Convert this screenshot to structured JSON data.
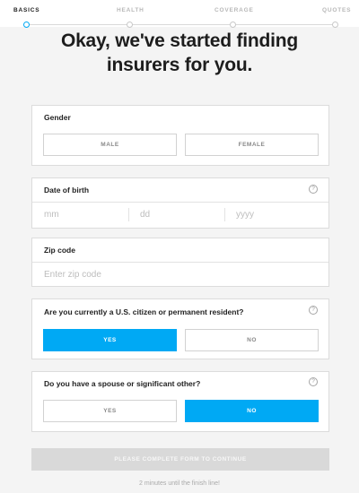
{
  "steps": [
    {
      "label": "BASICS",
      "active": true
    },
    {
      "label": "HEALTH",
      "active": false
    },
    {
      "label": "COVERAGE",
      "active": false
    },
    {
      "label": "QUOTES",
      "active": false
    }
  ],
  "headline": {
    "line1": "Okay, we've started finding",
    "line2": "insurers for you."
  },
  "gender": {
    "label": "Gender",
    "options": [
      "MALE",
      "FEMALE"
    ],
    "selected": null
  },
  "dob": {
    "label": "Date of birth",
    "help_icon": "?",
    "placeholders": [
      "mm",
      "dd",
      "yyyy"
    ]
  },
  "zip": {
    "label": "Zip code",
    "placeholder": "Enter zip code"
  },
  "citizen": {
    "label": "Are you currently a U.S. citizen or permanent resident?",
    "help_icon": "?",
    "options": [
      "YES",
      "NO"
    ],
    "selected": "YES"
  },
  "spouse": {
    "label": "Do you have a spouse or significant other?",
    "help_icon": "?",
    "options": [
      "YES",
      "NO"
    ],
    "selected": "NO"
  },
  "continue_label": "PLEASE COMPLETE FORM TO CONTINUE",
  "footnote": "2 minutes until the finish line!",
  "colors": {
    "accent": "#00a9f4",
    "disabled_button": "#d9d9d9",
    "background": "#f4f4f4"
  }
}
